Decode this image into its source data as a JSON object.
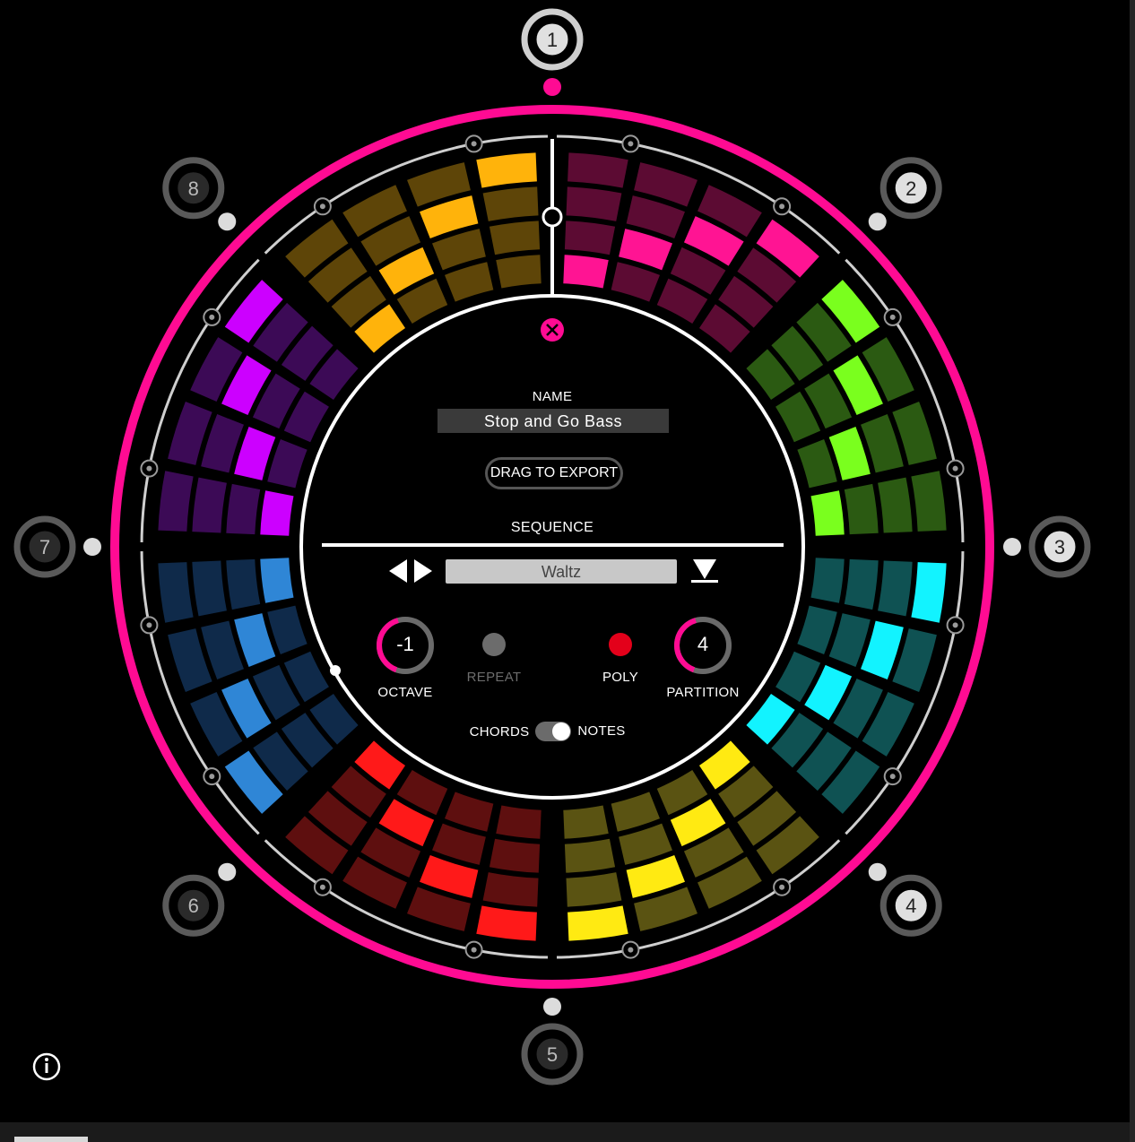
{
  "name_section": {
    "label": "NAME",
    "value": "Stop and Go Bass",
    "export_label": "DRAG TO EXPORT"
  },
  "sequence_section": {
    "label": "SEQUENCE",
    "selected": "Waltz"
  },
  "controls": {
    "octave": {
      "label": "OCTAVE",
      "value": "-1",
      "level": 0.45
    },
    "repeat": {
      "label": "REPEAT",
      "active": false
    },
    "poly": {
      "label": "POLY",
      "active": true
    },
    "partition": {
      "label": "PARTITION",
      "value": "4",
      "level": 0.45
    },
    "mode_left": "CHORDS",
    "mode_right": "NOTES"
  },
  "slots": [
    "1",
    "2",
    "3",
    "4",
    "5",
    "6",
    "7",
    "8"
  ],
  "active_slot": "1",
  "colors": {
    "ring": "#ff0b93",
    "segments": [
      {
        "bright": "#ff1493",
        "dim": "#5c0b33"
      },
      {
        "bright": "#7aff1e",
        "dim": "#2b5a12"
      },
      {
        "bright": "#12f3ff",
        "dim": "#0f5253"
      },
      {
        "bright": "#ffea12",
        "dim": "#5a5312"
      },
      {
        "bright": "#ff1919",
        "dim": "#5e0f0f"
      },
      {
        "bright": "#2f86d6",
        "dim": "#0f2a4a"
      },
      {
        "bright": "#cc00ff",
        "dim": "#3c0a56"
      },
      {
        "bright": "#ffb30b",
        "dim": "#5e4508"
      }
    ]
  },
  "patterns": [
    [
      [
        0,
        0,
        0,
        1
      ],
      [
        0,
        0,
        1,
        0
      ],
      [
        0,
        1,
        0,
        0
      ],
      [
        1,
        0,
        0,
        0
      ]
    ],
    [
      [
        1,
        0,
        0,
        0
      ],
      [
        0,
        1,
        0,
        0
      ],
      [
        0,
        0,
        1,
        0
      ],
      [
        0,
        0,
        0,
        1
      ]
    ],
    [
      [
        1,
        0,
        0,
        0
      ],
      [
        0,
        1,
        0,
        0
      ],
      [
        0,
        0,
        1,
        0
      ],
      [
        0,
        0,
        0,
        1
      ]
    ],
    [
      [
        0,
        0,
        0,
        1
      ],
      [
        0,
        0,
        1,
        0
      ],
      [
        0,
        1,
        0,
        0
      ],
      [
        1,
        0,
        0,
        0
      ]
    ],
    [
      [
        1,
        0,
        0,
        0
      ],
      [
        0,
        1,
        0,
        0
      ],
      [
        0,
        0,
        1,
        0
      ],
      [
        0,
        0,
        0,
        1
      ]
    ],
    [
      [
        1,
        0,
        0,
        0
      ],
      [
        0,
        1,
        0,
        0
      ],
      [
        0,
        0,
        1,
        0
      ],
      [
        0,
        0,
        0,
        1
      ]
    ],
    [
      [
        0,
        0,
        0,
        1
      ],
      [
        0,
        0,
        1,
        0
      ],
      [
        0,
        1,
        0,
        0
      ],
      [
        1,
        0,
        0,
        0
      ]
    ],
    [
      [
        0,
        0,
        0,
        1
      ],
      [
        0,
        0,
        1,
        0
      ],
      [
        0,
        1,
        0,
        0
      ],
      [
        1,
        0,
        0,
        0
      ]
    ]
  ],
  "icons": {
    "info": "info-icon",
    "close": "close-icon",
    "prev": "arrow-left-icon",
    "next": "arrow-right-icon",
    "download": "download-icon"
  }
}
